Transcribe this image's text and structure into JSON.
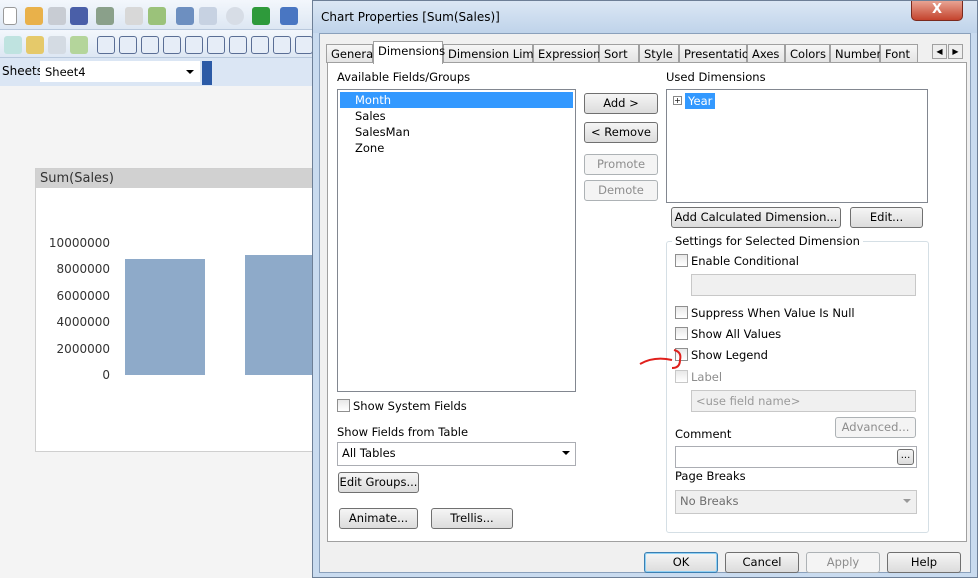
{
  "app": {
    "sheets_label": "Sheets",
    "sheet_value": "Sheet4"
  },
  "chart_data": {
    "type": "bar",
    "title": "Sum(Sales)",
    "yticks": [
      "10000000",
      "8000000",
      "6000000",
      "4000000",
      "2000000",
      "0"
    ],
    "ylim": [
      0,
      10000000
    ],
    "values": [
      8800000,
      9100000
    ],
    "bar_color": "#8eaac9",
    "legend": "none"
  },
  "dialog": {
    "title": "Chart Properties [Sum(Sales)]",
    "close": "X",
    "tabs": [
      "General",
      "Dimensions",
      "Dimension Limits",
      "Expressions",
      "Sort",
      "Style",
      "Presentation",
      "Axes",
      "Colors",
      "Number",
      "Font"
    ],
    "active_tab": "Dimensions",
    "available_label": "Available Fields/Groups",
    "available_fields": [
      "Month",
      "Sales",
      "SalesMan",
      "Zone"
    ],
    "selected_field": "Month",
    "add": "Add >",
    "remove": "< Remove",
    "promote": "Promote",
    "demote": "Demote",
    "used_label": "Used Dimensions",
    "used_dimensions": [
      "Year"
    ],
    "add_calc": "Add Calculated Dimension...",
    "edit": "Edit...",
    "settings_label": "Settings for Selected Dimension",
    "enable_conditional": "Enable Conditional",
    "suppress": "Suppress When Value Is Null",
    "show_all": "Show All Values",
    "show_legend": "Show Legend",
    "label": "Label",
    "label_placeholder": "<use field name>",
    "advanced": "Advanced...",
    "comment": "Comment",
    "ellipsis": "...",
    "page_breaks": "Page Breaks",
    "page_breaks_value": "No Breaks",
    "show_system": "Show System Fields",
    "show_from_table": "Show Fields from Table",
    "table_value": "All Tables",
    "edit_groups": "Edit Groups...",
    "animate": "Animate...",
    "trellis": "Trellis...",
    "ok": "OK",
    "cancel": "Cancel",
    "apply": "Apply",
    "help": "Help"
  },
  "annotation_color": "#e0201c"
}
